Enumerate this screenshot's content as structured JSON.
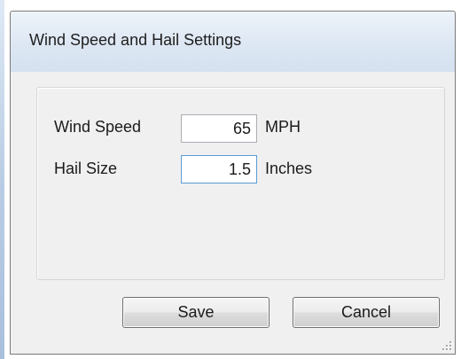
{
  "dialog": {
    "title": "Wind Speed and Hail Settings"
  },
  "fields": {
    "wind_speed": {
      "label": "Wind Speed",
      "value": "65",
      "unit": "MPH"
    },
    "hail_size": {
      "label": "Hail Size",
      "value": "1.5",
      "unit": "Inches"
    }
  },
  "buttons": {
    "save_label": "Save",
    "cancel_label": "Cancel"
  },
  "icons": {
    "resize_grip": "resize-grip-icon"
  },
  "colors": {
    "title_bar": "#dde7f3",
    "client_background": "#f0f0f0",
    "focus_border": "#5b9bd5"
  }
}
